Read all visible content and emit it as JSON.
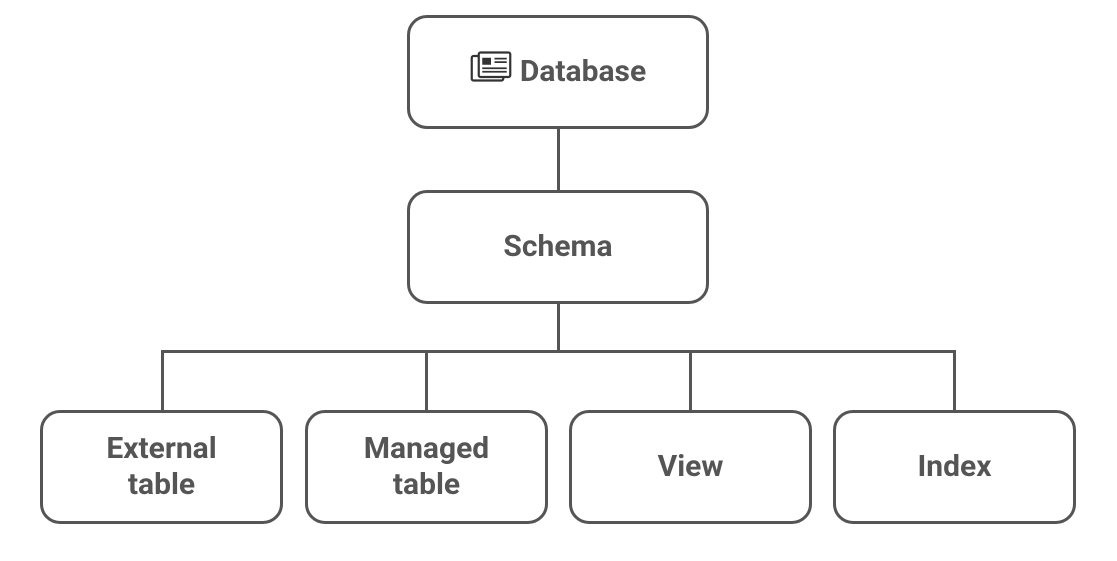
{
  "diagram": {
    "type": "hierarchy",
    "root": {
      "label": "Database",
      "has_icon": true,
      "icon_name": "database-newspaper-icon"
    },
    "level2": {
      "label": "Schema"
    },
    "leaves": [
      {
        "label": "External\ntable"
      },
      {
        "label": "Managed\ntable"
      },
      {
        "label": "View"
      },
      {
        "label": "Index"
      }
    ]
  },
  "colors": {
    "border": "#555555",
    "text": "#555555",
    "background": "#ffffff"
  }
}
